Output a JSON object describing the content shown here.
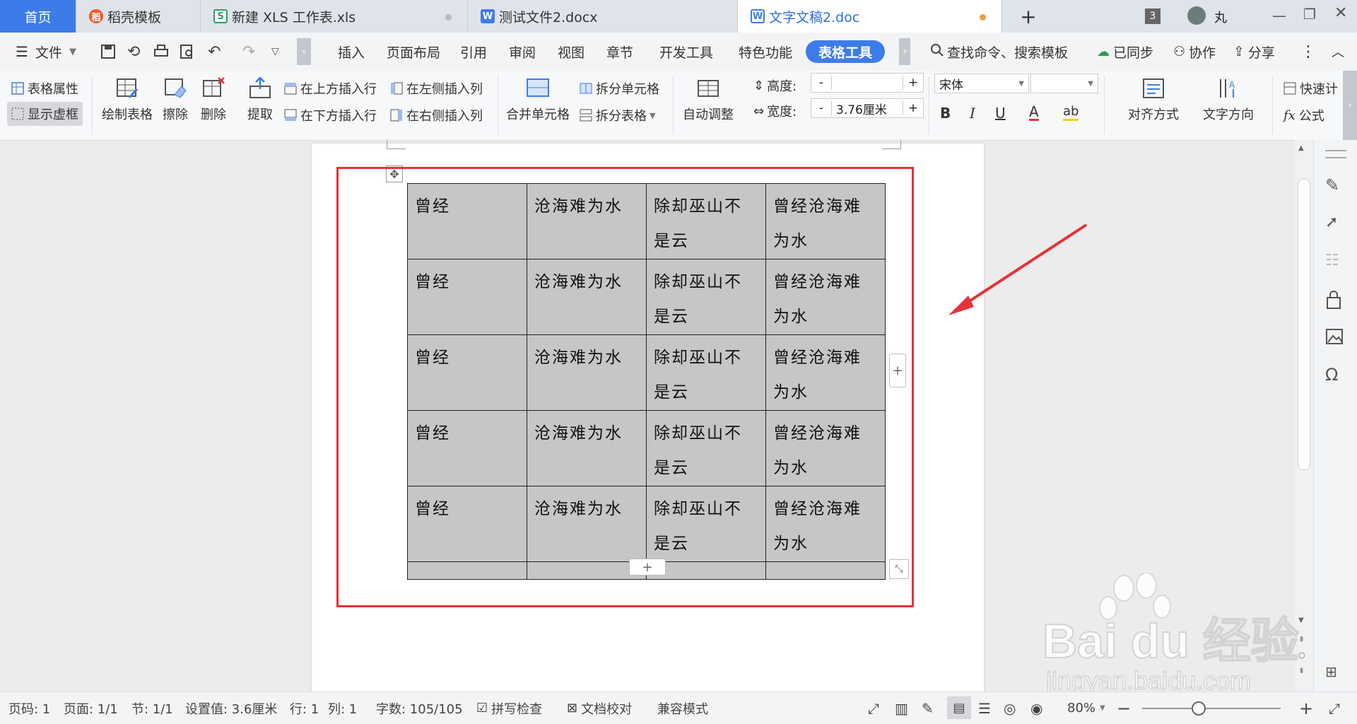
{
  "tabs": {
    "home": "首页",
    "t1": "稻壳模板",
    "t2": "新建 XLS 工作表.xls",
    "t3": "测试文件2.docx",
    "t4": "文字文稿2.doc",
    "add": "+",
    "window_count": "3",
    "user": "丸"
  },
  "menu": {
    "file": "文件",
    "insert": "插入",
    "layout": "页面布局",
    "ref": "引用",
    "review": "审阅",
    "view": "视图",
    "chapter": "章节",
    "dev": "开发工具",
    "special": "特色功能",
    "table_tools": "表格工具",
    "search": "查找命令、搜索模板",
    "synced": "已同步",
    "collab": "协作",
    "share": "分享"
  },
  "ribbon": {
    "table_props": "表格属性",
    "show_grid": "显示虚框",
    "draw_table": "绘制表格",
    "erase": "擦除",
    "delete": "删除",
    "extract": "提取",
    "insert_above": "在上方插入行",
    "insert_below": "在下方插入行",
    "insert_left": "在左侧插入列",
    "insert_right": "在右侧插入列",
    "merge_cells": "合并单元格",
    "split_cells": "拆分单元格",
    "split_table": "拆分表格",
    "auto_adjust": "自动调整",
    "height_label": "高度:",
    "height_value": "",
    "width_label": "宽度:",
    "width_value": "3.76厘米",
    "font_name": "宋体",
    "font_size": "",
    "bold": "B",
    "italic": "I",
    "underline": "U",
    "font_color": "A",
    "highlight": "ab",
    "align": "对齐方式",
    "text_dir": "文字方向",
    "quick_calc": "快速计",
    "formula": "公式"
  },
  "table": {
    "rows": [
      [
        "曾经",
        "沧海难为水",
        "除却巫山不是云",
        "曾经沧海难为水"
      ],
      [
        "曾经",
        "沧海难为水",
        "除却巫山不是云",
        "曾经沧海难为水"
      ],
      [
        "曾经",
        "沧海难为水",
        "除却巫山不是云",
        "曾经沧海难为水"
      ],
      [
        "曾经",
        "沧海难为水",
        "除却巫山不是云",
        "曾经沧海难为水"
      ],
      [
        "曾经",
        "沧海难为水",
        "除却巫山不是云",
        "曾经沧海难为水"
      ],
      [
        "",
        "",
        "",
        ""
      ]
    ],
    "add_row": "+",
    "add_col": "+"
  },
  "status": {
    "page_no": "页码: 1",
    "pages": "页面: 1/1",
    "section": "节: 1/1",
    "setting": "设置值: 3.6厘米",
    "row": "行: 1",
    "col": "列: 1",
    "words": "字数: 105/105",
    "spell": "拼写检查",
    "proof": "文档校对",
    "compat": "兼容模式",
    "zoom": "80%"
  },
  "watermark": {
    "brand": "Bai du 经验",
    "url": "jingyan.baidu.com"
  },
  "colors": {
    "accent": "#3d7ce8",
    "highlight_border": "#e53238",
    "table_fill": "#c6c6c6"
  }
}
